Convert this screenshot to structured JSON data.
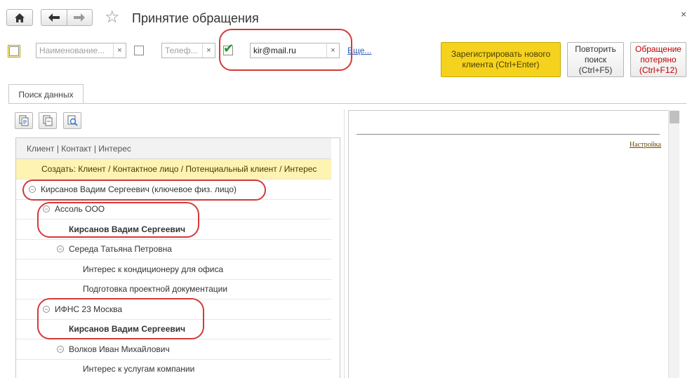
{
  "header": {
    "title": "Принятие обращения",
    "home_icon": "home-icon",
    "back_icon": "arrow-left-icon",
    "forward_icon": "arrow-right-icon",
    "favorite_icon": "star-icon",
    "close_glyph": "×"
  },
  "filters": {
    "name_placeholder": "Наименование...",
    "phone_placeholder": "Телеф...",
    "email_value": "kir@mail.ru",
    "email_checked": true,
    "clear_glyph": "×",
    "more_link": "Еще..."
  },
  "actions": {
    "register": "Зарегистрировать нового клиента (Ctrl+Enter)",
    "repeat": "Повторить поиск (Ctrl+F5)",
    "lost": "Обращение потеряно (Ctrl+F12)"
  },
  "tabs": [
    {
      "label": "Поиск данных",
      "active": true
    }
  ],
  "tree": {
    "header": "Клиент | Контакт | Интерес",
    "rows": [
      {
        "label": "Создать: Клиент / Контактное лицо / Потенциальный клиент / Интерес",
        "level": 0,
        "toggle": false,
        "bold": false,
        "create": true
      },
      {
        "label": "Кирсанов Вадим Сергеевич (ключевое физ. лицо)",
        "level": 0,
        "toggle": true,
        "bold": false
      },
      {
        "label": "Ассоль ООО",
        "level": 1,
        "toggle": true,
        "bold": false
      },
      {
        "label": "Кирсанов Вадим Сергеевич",
        "level": 2,
        "toggle": false,
        "bold": true
      },
      {
        "label": "Середа Татьяна Петровна",
        "level": 2,
        "toggle": true,
        "bold": false
      },
      {
        "label": "Интерес к кондиционеру для офиса",
        "level": 3,
        "toggle": false,
        "bold": false
      },
      {
        "label": "Подготовка проектной документации",
        "level": 3,
        "toggle": false,
        "bold": false
      },
      {
        "label": "ИФНС 23 Москва",
        "level": 1,
        "toggle": true,
        "bold": false
      },
      {
        "label": "Кирсанов Вадим Сергеевич",
        "level": 2,
        "toggle": false,
        "bold": true
      },
      {
        "label": "Волков Иван Михайлович",
        "level": 2,
        "toggle": true,
        "bold": false
      },
      {
        "label": "Интерес к услугам компании",
        "level": 3,
        "toggle": false,
        "bold": false
      }
    ]
  },
  "right_panel": {
    "settings_link": "Настройка"
  },
  "colors": {
    "accent_yellow": "#f5d21e",
    "annotation_red": "#d23a3a",
    "lost_red": "#c00000",
    "link_blue": "#2f5fb5"
  }
}
